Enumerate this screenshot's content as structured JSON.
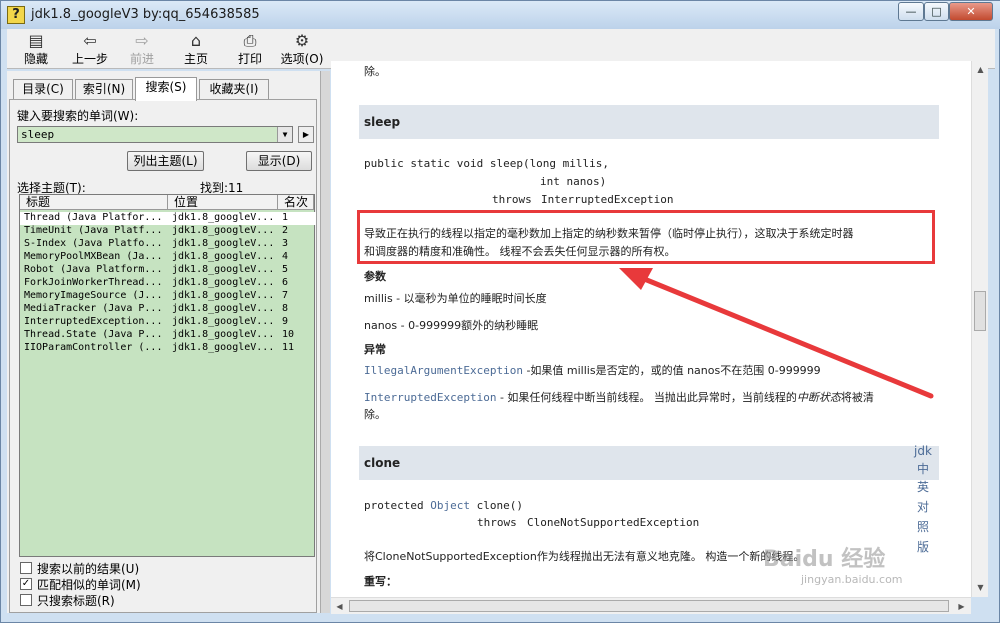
{
  "window": {
    "title": "jdk1.8_googleV3 by:qq_654638585",
    "min": "—",
    "max": "□",
    "close": "✕"
  },
  "toolbar": [
    {
      "label": "隐藏",
      "icon": "▤"
    },
    {
      "label": "上一步",
      "icon": "⇦"
    },
    {
      "label": "前进",
      "icon": "⇨"
    },
    {
      "label": "主页",
      "icon": "⌂"
    },
    {
      "label": "打印",
      "icon": "⎙"
    },
    {
      "label": "选项(O)",
      "icon": "⚙"
    }
  ],
  "tabs": [
    "目录(C)",
    "索引(N)",
    "搜索(S)",
    "收藏夹(I)"
  ],
  "search": {
    "prompt": "键入要搜索的单词(W):",
    "value": "sleep",
    "list_topics": "列出主题(L)",
    "display": "显示(D)",
    "select_topic": "选择主题(T):",
    "found": "找到:11"
  },
  "results": {
    "headers": [
      "标题",
      "位置",
      "名次"
    ],
    "rows": [
      {
        "title": "Thread (Java Platfor...",
        "loc": "jdk1.8_googleV...",
        "rank": "1"
      },
      {
        "title": "TimeUnit (Java Platf...",
        "loc": "jdk1.8_googleV...",
        "rank": "2"
      },
      {
        "title": "S-Index (Java Platfo...",
        "loc": "jdk1.8_googleV...",
        "rank": "3"
      },
      {
        "title": "MemoryPoolMXBean (Ja...",
        "loc": "jdk1.8_googleV...",
        "rank": "4"
      },
      {
        "title": "Robot (Java Platform...",
        "loc": "jdk1.8_googleV...",
        "rank": "5"
      },
      {
        "title": "ForkJoinWorkerThread...",
        "loc": "jdk1.8_googleV...",
        "rank": "6"
      },
      {
        "title": "MemoryImageSource (J...",
        "loc": "jdk1.8_googleV...",
        "rank": "7"
      },
      {
        "title": "MediaTracker (Java P...",
        "loc": "jdk1.8_googleV...",
        "rank": "8"
      },
      {
        "title": "InterruptedException...",
        "loc": "jdk1.8_googleV...",
        "rank": "9"
      },
      {
        "title": "Thread.State (Java P...",
        "loc": "jdk1.8_googleV...",
        "rank": "10"
      },
      {
        "title": "IIOParamController (...",
        "loc": "jdk1.8_googleV...",
        "rank": "11"
      }
    ]
  },
  "options": [
    {
      "label": "搜索以前的结果(U)",
      "checked": false
    },
    {
      "label": "匹配相似的单词(M)",
      "checked": true
    },
    {
      "label": "只搜索标题(R)",
      "checked": false
    }
  ],
  "doc": {
    "prev_tail": "除。",
    "sleep": {
      "name": "sleep",
      "sig1": "public static void sleep(long millis,",
      "sig2": "int nanos)",
      "sig3_kw": "throws",
      "sig3_link": "InterruptedException",
      "desc1": "导致正在执行的线程以指定的毫秒数加上指定的纳秒数来暂停（临时停止执行），这取决于系统定时器",
      "desc2": "和调度器的精度和准确性。 线程不会丢失任何显示器的所有权。",
      "params_h": "参数",
      "p1": "millis - 以毫秒为单位的睡眠时间长度",
      "p2": "nanos - 0-999999额外的纳秒睡眠",
      "throws_h": "异常",
      "t1_link": "IllegalArgumentException",
      "t1_text": " -如果值 millis是否定的，或的值 nanos不在范围 0-999999",
      "t2_link": "InterruptedException",
      "t2_text": " - 如果任何线程中断当前线程。 当抛出此异常时，当前线程的",
      "t2_italic": "中断状态",
      "t2_tail": "将被清",
      "t2_line2": "除。"
    },
    "clone": {
      "name": "clone",
      "sig_pre": "protected ",
      "sig_link": "Object",
      "sig_post": " clone()",
      "throws_kw": "throws",
      "throws_link": "CloneNotSupportedException",
      "desc": "将CloneNotSupportedException作为线程抛出无法有意义地克隆。 构造一个新的线程。",
      "override_h": "重写："
    },
    "side_links": [
      "jdk",
      "中",
      "英",
      "对",
      "照",
      "版"
    ]
  },
  "watermark": {
    "brand": "Baidu 经验",
    "url": "jingyan.baidu.com"
  },
  "colors": {
    "highlight_box": "#e8393b",
    "arrow": "#e8393b",
    "list_bg": "#c6e3c1",
    "link": "#4c6b96"
  }
}
